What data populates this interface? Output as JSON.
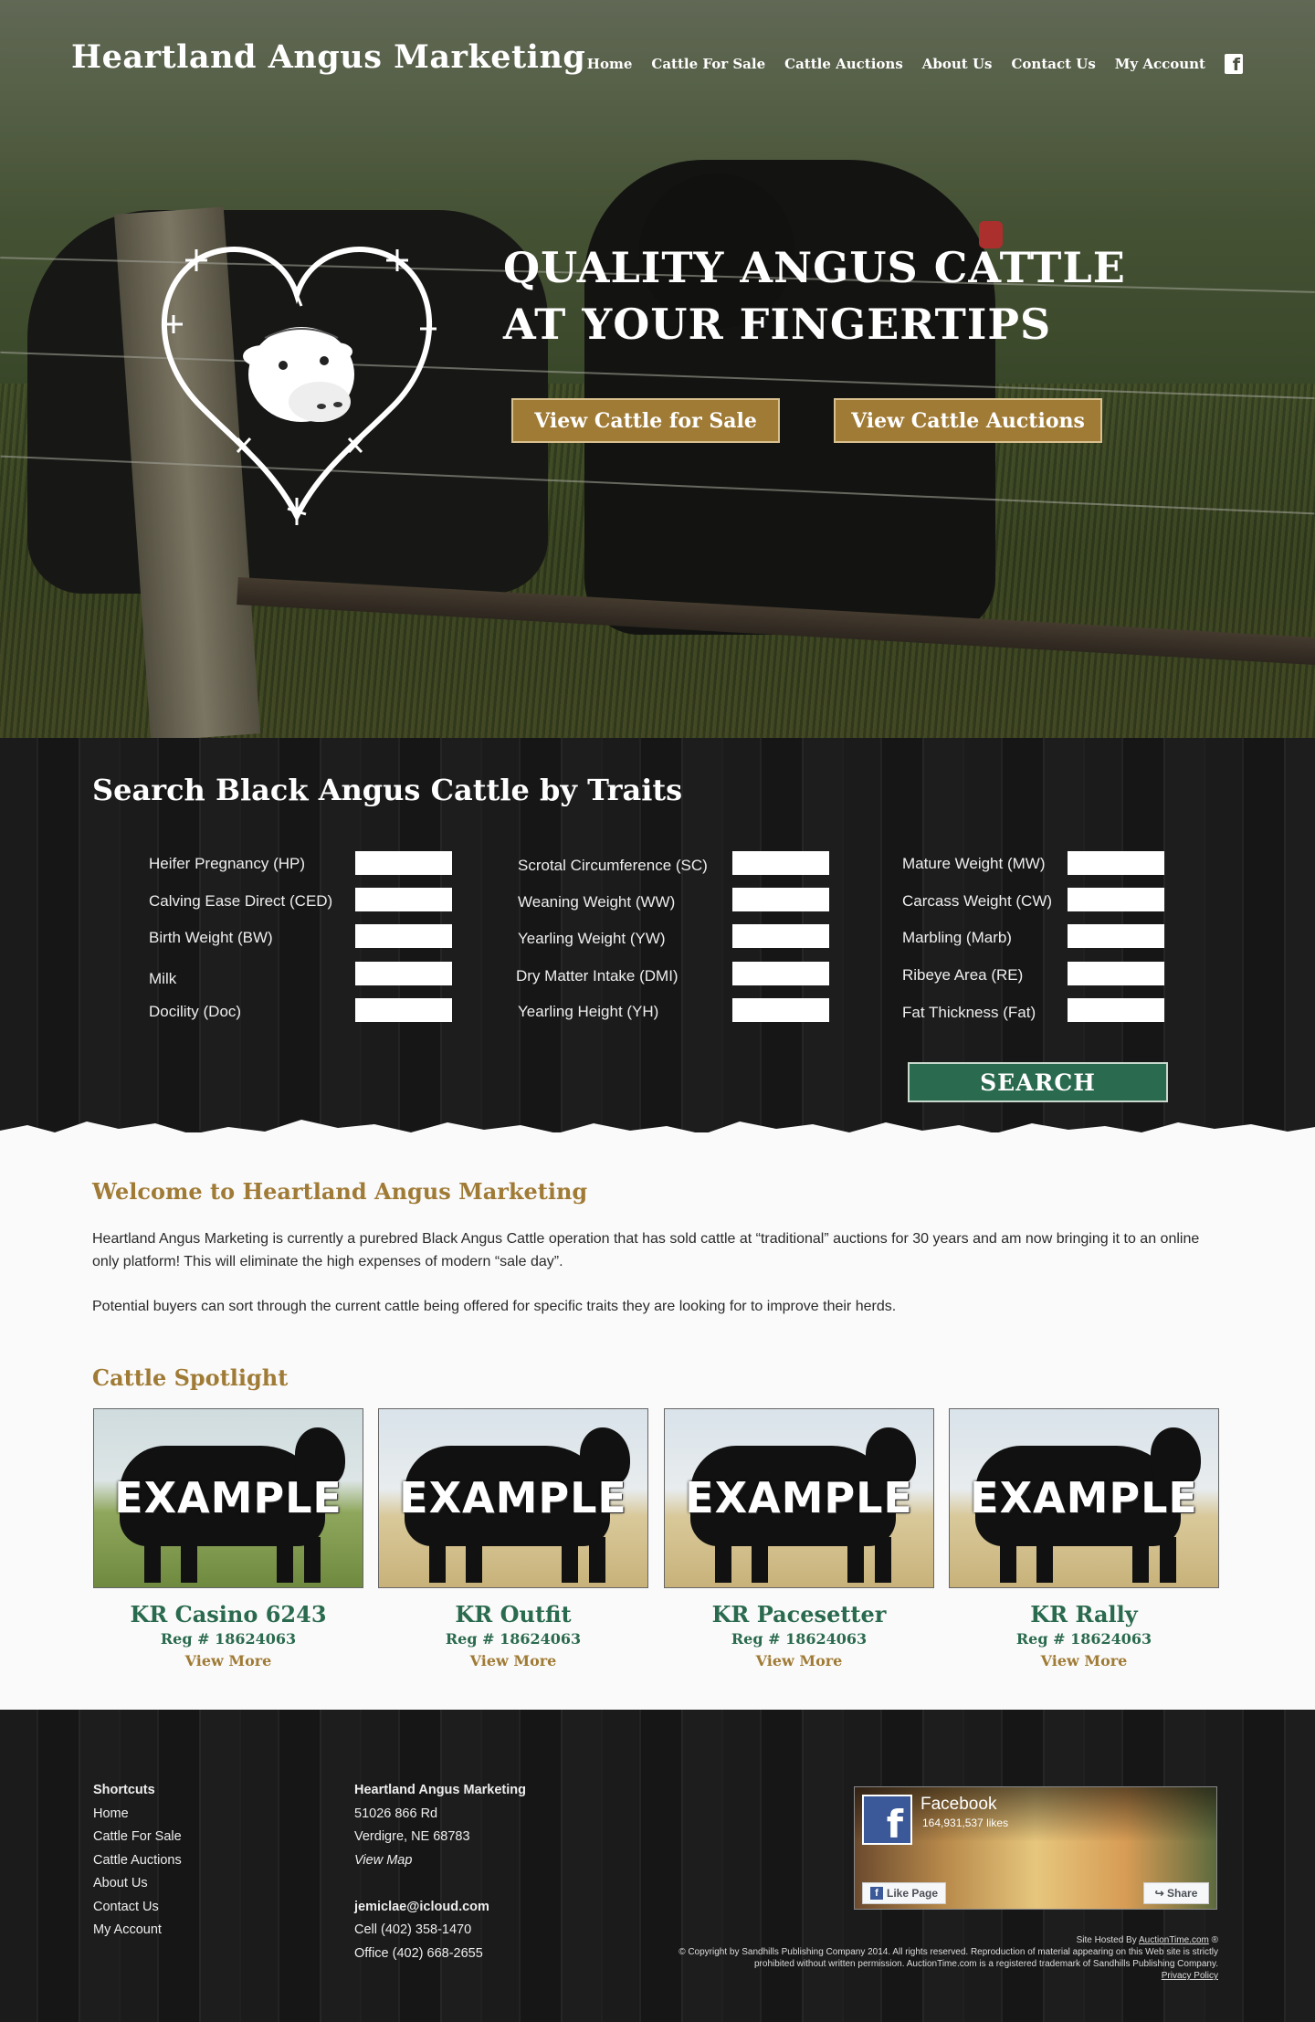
{
  "header": {
    "site_title": "Heartland Angus Marketing",
    "nav": [
      "Home",
      "Cattle For Sale",
      "Cattle Auctions",
      "About Us",
      "Contact Us",
      "My Account"
    ],
    "facebook_icon": "facebook-icon"
  },
  "hero": {
    "headline": "QUALITY ANGUS CATTLE AT YOUR FINGERTIPS",
    "cta_primary": "View Cattle for Sale",
    "cta_secondary": "View Cattle Auctions",
    "accent_color": "#a07b36"
  },
  "search": {
    "title": "Search Black Angus Cattle by Traits",
    "columns": [
      [
        "Heifer Pregnancy (HP)",
        "Calving Ease Direct (CED)",
        "Birth Weight (BW)",
        "Milk",
        "Docility (Doc)"
      ],
      [
        "Scrotal Circumference (SC)",
        "Weaning Weight (WW)",
        "Yearling Weight (YW)",
        "Dry Matter Intake (DMI)",
        "Yearling Height (YH)"
      ],
      [
        "Mature Weight (MW)",
        "Carcass Weight (CW)",
        "Marbling (Marb)",
        "Ribeye Area (RE)",
        "Fat Thickness (Fat)"
      ]
    ],
    "button": "SEARCH",
    "button_color": "#2a6a4e"
  },
  "welcome": {
    "title": "Welcome to Heartland Angus Marketing",
    "p1": "Heartland Angus Marketing is currently a purebred Black Angus Cattle operation that has sold cattle at “traditional” auctions for 30 years and am now bringing it to an online only platform! This will eliminate the high expenses of modern “sale day”.",
    "p2": "Potential buyers can sort through the current cattle being offered for specific traits they are looking for to improve their herds."
  },
  "spotlight": {
    "title": "Cattle Spotlight",
    "cards": [
      {
        "overlay": "EXAMPLE",
        "name": "KR Casino 6243",
        "reg": "Reg # 18624063",
        "more": "View More"
      },
      {
        "overlay": "EXAMPLE",
        "name": "KR Outfit",
        "reg": "Reg # 18624063",
        "more": "View More"
      },
      {
        "overlay": "EXAMPLE",
        "name": "KR Pacesetter",
        "reg": "Reg # 18624063",
        "more": "View More"
      },
      {
        "overlay": "EXAMPLE",
        "name": "KR Rally",
        "reg": "Reg # 18624063",
        "more": "View More"
      }
    ]
  },
  "footer": {
    "shortcuts_title": "Shortcuts",
    "shortcuts": [
      "Home",
      "Cattle For Sale",
      "Cattle Auctions",
      "About Us",
      "Contact Us",
      "My Account"
    ],
    "company": "Heartland Angus Marketing",
    "address1": "51026 866 Rd",
    "address2": "Verdigre, NE 68783",
    "map_link": "View Map",
    "email": "jemiclae@icloud.com",
    "cell": "Cell (402) 358-1470",
    "office": "Office (402) 668-2655",
    "fb_widget": {
      "title": "Facebook",
      "likes": "164,931,537 likes",
      "like": "Like Page",
      "share": "Share"
    },
    "hosted_prefix": "Site Hosted By",
    "hosted_link": "AuctionTime.com",
    "copyright": "© Copyright by Sandhills Publishing Company 2014. All rights reserved. Reproduction of material appearing on this Web site is strictly prohibited without written permission. AuctionTime.com is a registered trademark of Sandhills Publishing Company.",
    "privacy": "Privacy Policy"
  }
}
